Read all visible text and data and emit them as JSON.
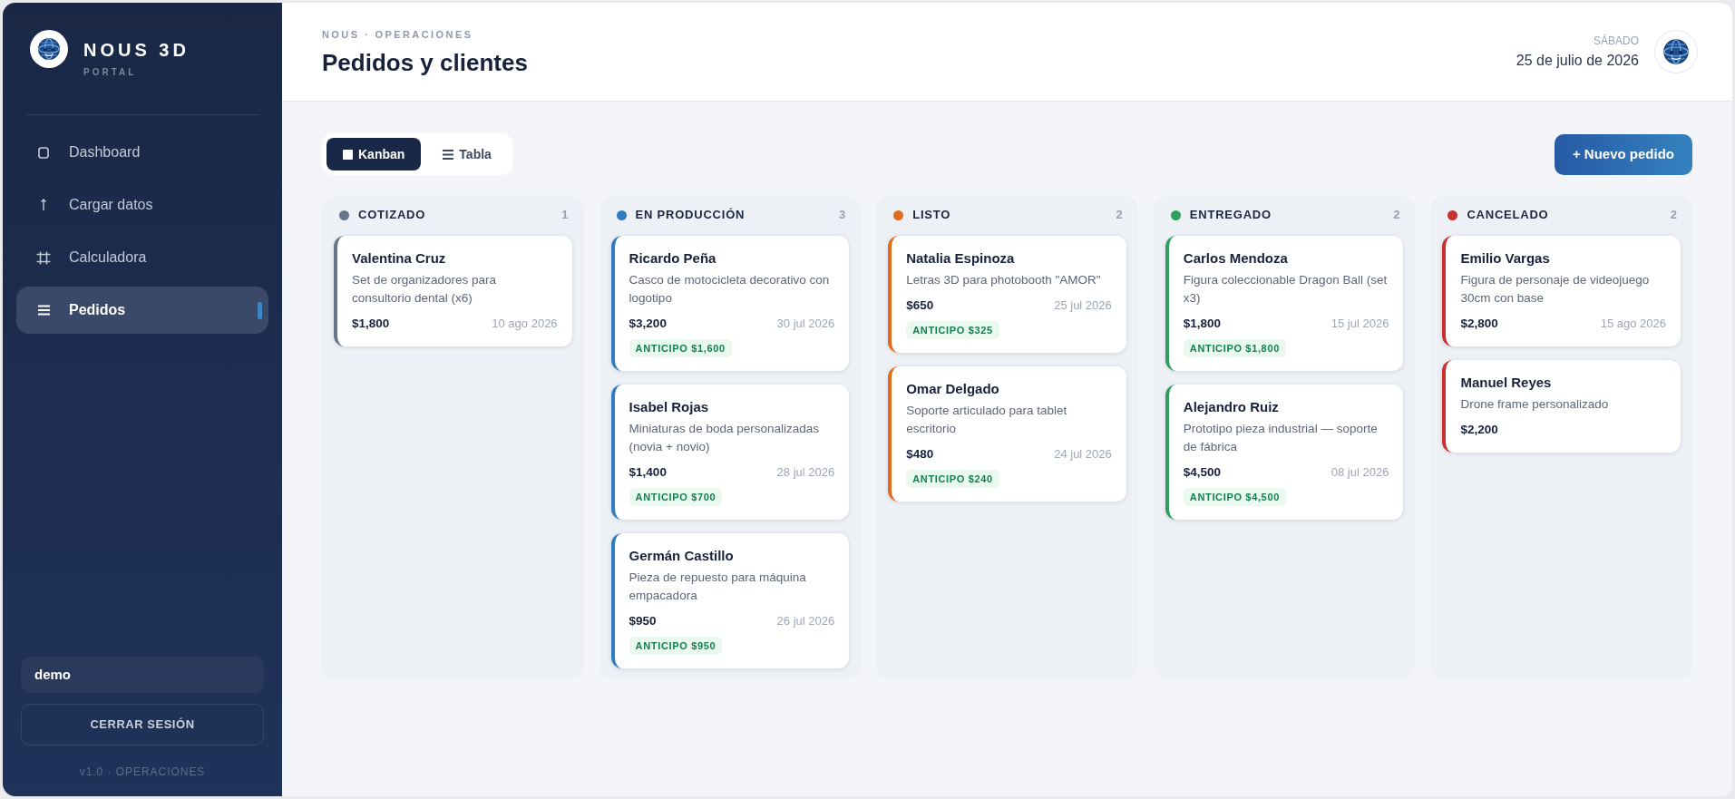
{
  "sidebar": {
    "brand": "NOUS 3D",
    "subtitle": "PORTAL",
    "nav": [
      {
        "label": "Dashboard",
        "selected": false
      },
      {
        "label": "Cargar datos",
        "selected": false
      },
      {
        "label": "Calculadora",
        "selected": false
      },
      {
        "label": "Pedidos",
        "selected": true
      }
    ],
    "user": "demo",
    "logout": "CERRAR SESIÓN",
    "version": "v1.0 · OPERACIONES"
  },
  "header": {
    "breadcrumb": "NOUS · OPERACIONES",
    "title": "Pedidos y clientes",
    "weekday": "SÁBADO",
    "date": "25 de julio de 2026"
  },
  "toolbar": {
    "views": [
      {
        "label": "Kanban",
        "selected": true
      },
      {
        "label": "Tabla",
        "selected": false
      }
    ],
    "new_order": "+ Nuevo pedido"
  },
  "columns": [
    {
      "title": "COTIZADO",
      "count": "1",
      "color": "#64748b",
      "cards": [
        {
          "client": "Valentina Cruz",
          "description": "Set de organizadores para consultorio dental (x6)",
          "amount": "$1,800",
          "date": "10 ago 2026"
        }
      ]
    },
    {
      "title": "EN PRODUCCIÓN",
      "count": "3",
      "color": "#2f7dc0",
      "cards": [
        {
          "client": "Ricardo Peña",
          "description": "Casco de motocicleta decorativo con logotipo",
          "amount": "$3,200",
          "date": "30 jul 2026",
          "deposit": "ANTICIPO $1,600"
        },
        {
          "client": "Isabel Rojas",
          "description": "Miniaturas de boda personalizadas (novia + novio)",
          "amount": "$1,400",
          "date": "28 jul 2026",
          "deposit": "ANTICIPO $700"
        },
        {
          "client": "Germán Castillo",
          "description": "Pieza de repuesto para máquina empacadora",
          "amount": "$950",
          "date": "26 jul 2026",
          "deposit": "ANTICIPO $950"
        }
      ]
    },
    {
      "title": "LISTO",
      "count": "2",
      "color": "#e06a1e",
      "cards": [
        {
          "client": "Natalia Espinoza",
          "description": "Letras 3D para photobooth \"AMOR\"",
          "amount": "$650",
          "date": "25 jul 2026",
          "deposit": "ANTICIPO $325"
        },
        {
          "client": "Omar Delgado",
          "description": "Soporte articulado para tablet escritorio",
          "amount": "$480",
          "date": "24 jul 2026",
          "deposit": "ANTICIPO $240"
        }
      ]
    },
    {
      "title": "ENTREGADO",
      "count": "2",
      "color": "#2f9e5f",
      "cards": [
        {
          "client": "Carlos Mendoza",
          "description": "Figura coleccionable Dragon Ball (set x3)",
          "amount": "$1,800",
          "date": "15 jul 2026",
          "deposit": "ANTICIPO $1,800"
        },
        {
          "client": "Alejandro Ruiz",
          "description": "Prototipo pieza industrial — soporte de fábrica",
          "amount": "$4,500",
          "date": "08 jul 2026",
          "deposit": "ANTICIPO $4,500"
        }
      ]
    },
    {
      "title": "CANCELADO",
      "count": "2",
      "color": "#c93030",
      "cards": [
        {
          "client": "Emilio Vargas",
          "description": "Figura de personaje de videojuego 30cm con base",
          "amount": "$2,800",
          "date": "15 ago 2026"
        },
        {
          "client": "Manuel Reyes",
          "description": "Drone frame personalizado",
          "amount": "$2,200"
        }
      ]
    }
  ]
}
